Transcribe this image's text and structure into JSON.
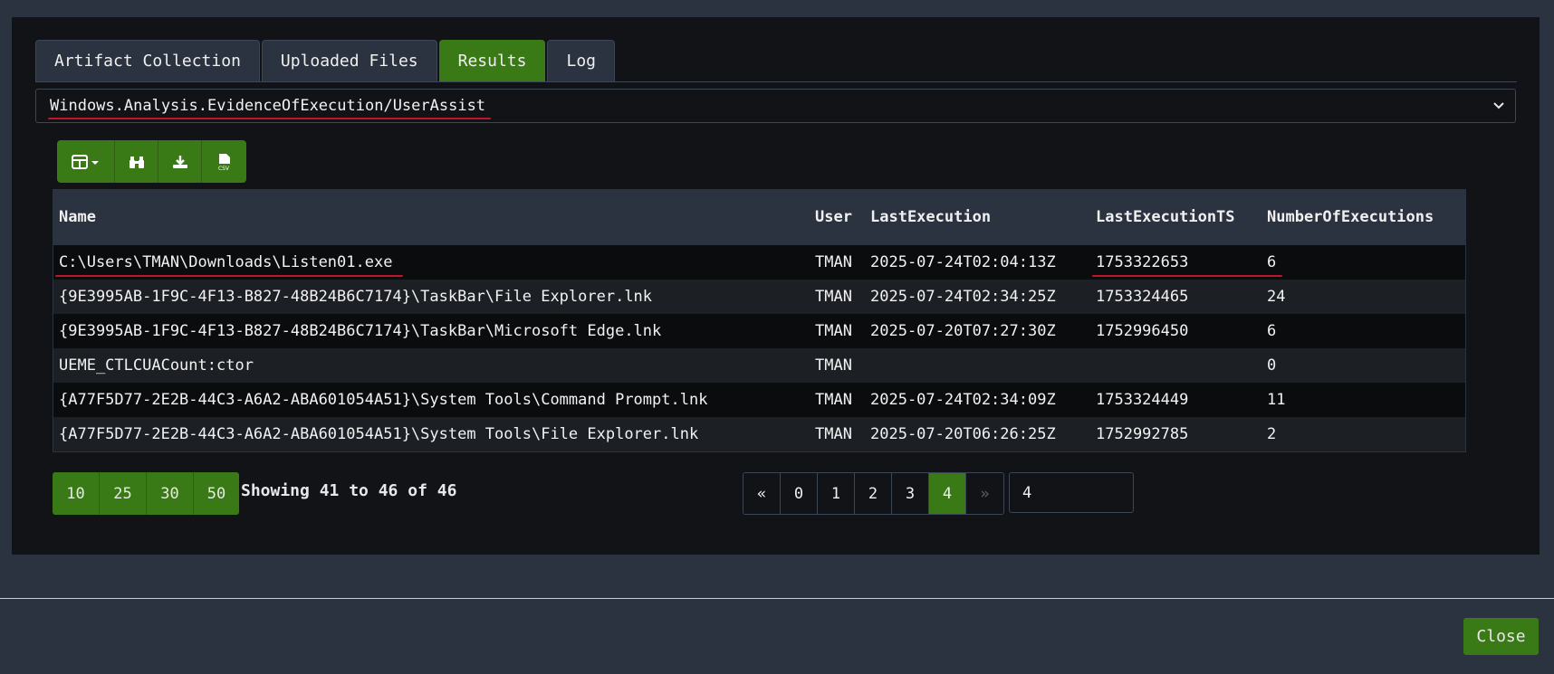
{
  "tabs": [
    {
      "label": "Artifact Collection"
    },
    {
      "label": "Uploaded Files"
    },
    {
      "label": "Results"
    },
    {
      "label": "Log"
    }
  ],
  "active_tab": "Results",
  "artifact_select": {
    "value": "Windows.Analysis.EvidenceOfExecution/UserAssist"
  },
  "toolbar": {
    "icons": [
      "columns-dropdown-icon",
      "binoculars-icon",
      "download-icon",
      "csv-file-icon"
    ]
  },
  "table": {
    "columns": [
      "Name",
      "User",
      "LastExecution",
      "LastExecutionTS",
      "NumberOfExecutions"
    ],
    "rows": [
      {
        "name": "C:\\Users\\TMAN\\Downloads\\Listen01.exe",
        "user": "TMAN",
        "last": "2025-07-24T02:04:13Z",
        "ts": "1753322653",
        "num": "6"
      },
      {
        "name": "{9E3995AB-1F9C-4F13-B827-48B24B6C7174}\\TaskBar\\File Explorer.lnk",
        "user": "TMAN",
        "last": "2025-07-24T02:34:25Z",
        "ts": "1753324465",
        "num": "24"
      },
      {
        "name": "{9E3995AB-1F9C-4F13-B827-48B24B6C7174}\\TaskBar\\Microsoft Edge.lnk",
        "user": "TMAN",
        "last": "2025-07-20T07:27:30Z",
        "ts": "1752996450",
        "num": "6"
      },
      {
        "name": "UEME_CTLCUACount:ctor",
        "user": "TMAN",
        "last": "",
        "ts": "",
        "num": "0"
      },
      {
        "name": "{A77F5D77-2E2B-44C3-A6A2-ABA601054A51}\\System Tools\\Command Prompt.lnk",
        "user": "TMAN",
        "last": "2025-07-24T02:34:09Z",
        "ts": "1753324449",
        "num": "11"
      },
      {
        "name": "{A77F5D77-2E2B-44C3-A6A2-ABA601054A51}\\System Tools\\File Explorer.lnk",
        "user": "TMAN",
        "last": "2025-07-20T06:26:25Z",
        "ts": "1752992785",
        "num": "2"
      }
    ]
  },
  "page_sizes": [
    "10",
    "25",
    "30",
    "50"
  ],
  "showing_text": "Showing 41 to 46 of 46",
  "pagination": {
    "prev": "«",
    "pages": [
      "0",
      "1",
      "2",
      "3",
      "4"
    ],
    "current": "4",
    "next": "»",
    "goto_value": "4"
  },
  "close_label": "Close",
  "colors": {
    "accent": "#3a7a16",
    "annotation": "#c0162a",
    "background": "#111316",
    "chrome": "#2b3240"
  }
}
